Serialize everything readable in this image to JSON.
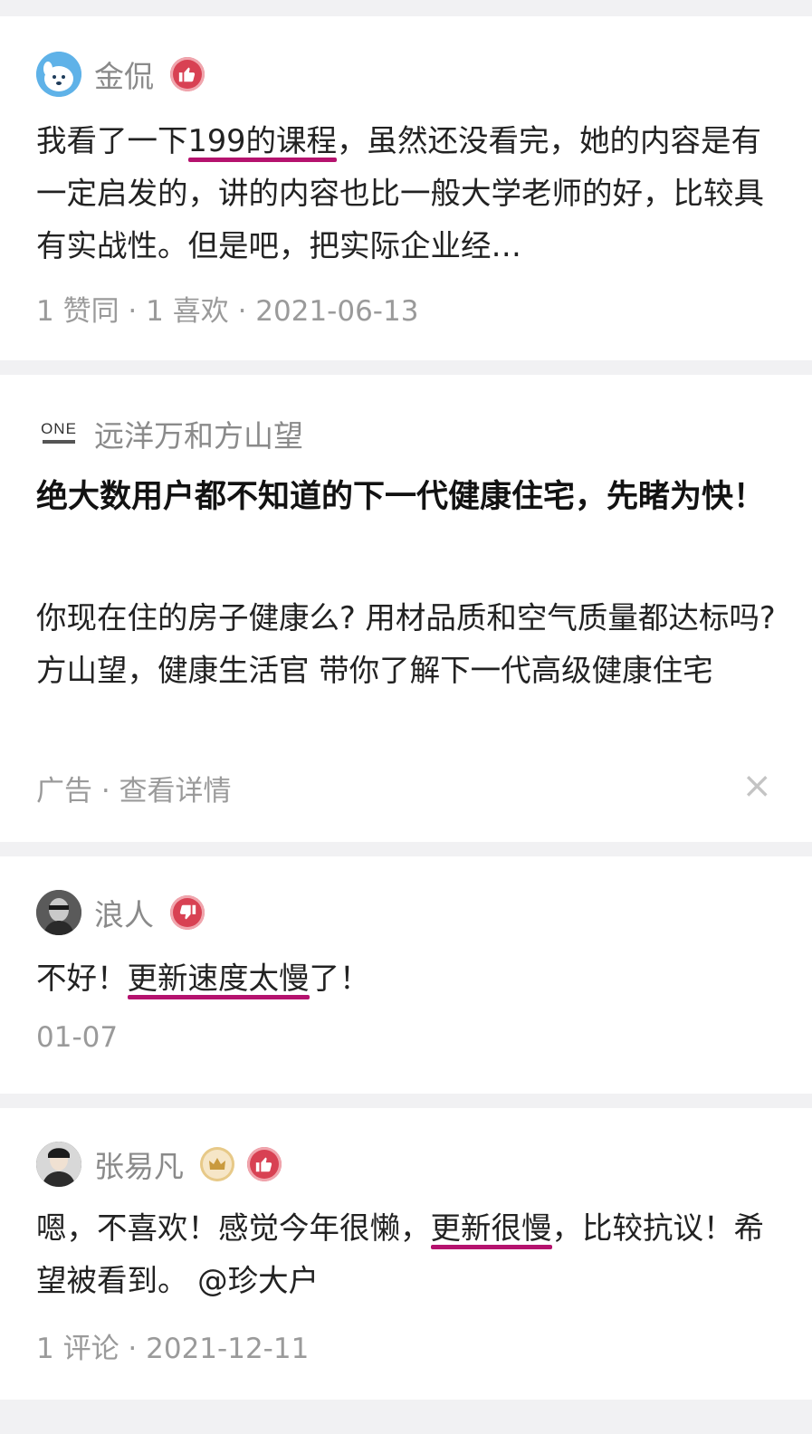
{
  "feed": {
    "answer1": {
      "author": "金侃",
      "badge_icon": "thumbs-up-icon",
      "text_before": "我看了一下",
      "text_highlight": "199的课程",
      "text_after": "，虽然还没看完，她的内容是有一定启发的，讲的内容也比一般大学老师的好，比较具有实战性。但是吧，把实际企业经…",
      "meta": "1 赞同 · 1 喜欢 · 2021-06-13"
    },
    "ad": {
      "brand_logo_text": "ONE",
      "advertiser": "远洋万和方山望",
      "title": "绝大数用户都不知道的下一代健康住宅，先睹为快！",
      "description": "你现在住的房子健康么? 用材品质和空气质量都达标吗? 方山望，健康生活官 带你了解下一代高级健康住宅",
      "meta": "广告 · 查看详情",
      "close_glyph": "×"
    },
    "answer2": {
      "author": "浪人",
      "badge_icon": "thumbs-down-icon",
      "text_before": "不好！",
      "text_highlight": "更新速度太慢",
      "text_after": "了！",
      "meta": "01-07"
    },
    "answer3": {
      "author": "张易凡",
      "badge_icon": "thumbs-up-icon",
      "text_before": "嗯，不喜欢！感觉今年很懒，",
      "text_highlight": "更新很慢",
      "text_after": "，比较抗议！希望被看到。 @珍大户",
      "meta": "1 评论 · 2021-12-11"
    }
  },
  "colors": {
    "highlight_underline": "#b5126e",
    "badge_red": "#d84153",
    "meta_gray": "#9a9a9a",
    "page_bg": "#f1f1f3"
  }
}
